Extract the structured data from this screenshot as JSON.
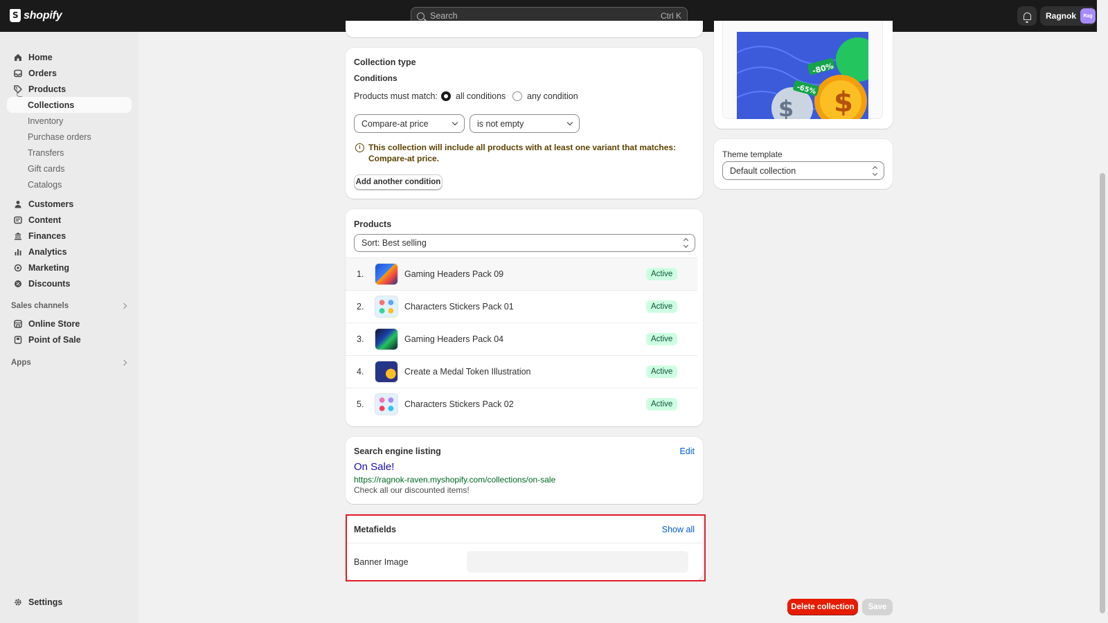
{
  "topbar": {
    "brand": "shopify",
    "search_placeholder": "Search",
    "search_shortcut": "Ctrl K",
    "user_name": "Ragnok",
    "avatar_initials": "Rag"
  },
  "sidebar": {
    "main": [
      "Home",
      "Orders",
      "Products"
    ],
    "products_sub": [
      "Collections",
      "Inventory",
      "Purchase orders",
      "Transfers",
      "Gift cards",
      "Catalogs"
    ],
    "more": [
      "Customers",
      "Content",
      "Finances",
      "Analytics",
      "Marketing",
      "Discounts"
    ],
    "sales_channels_heading": "Sales channels",
    "sales_channels": [
      "Online Store",
      "Point of Sale"
    ],
    "apps_heading": "Apps",
    "settings": "Settings"
  },
  "collection_type": {
    "title": "Collection type",
    "conditions_label": "Conditions",
    "match_label": "Products must match:",
    "option_all": "all conditions",
    "option_any": "any condition",
    "selected_option": "all conditions",
    "field_select": "Compare-at price",
    "operator_select": "is not empty",
    "notice": "This collection will include all products with at least one variant that matches: Compare-at price.",
    "add_condition_button": "Add another condition"
  },
  "products": {
    "title": "Products",
    "sort_label": "Sort: Best selling",
    "items": [
      {
        "num": "1.",
        "name": "Gaming Headers Pack 09",
        "status": "Active"
      },
      {
        "num": "2.",
        "name": "Characters Stickers Pack 01",
        "status": "Active"
      },
      {
        "num": "3.",
        "name": "Gaming Headers Pack 04",
        "status": "Active"
      },
      {
        "num": "4.",
        "name": "Create a Medal Token Illustration",
        "status": "Active"
      },
      {
        "num": "5.",
        "name": "Characters Stickers Pack 02",
        "status": "Active"
      }
    ]
  },
  "seo": {
    "title": "Search engine listing",
    "edit_label": "Edit",
    "page_title": "On Sale!",
    "url": "https://ragnok-raven.myshopify.com/collections/on-sale",
    "description": "Check all our discounted items!"
  },
  "metafields": {
    "title": "Metafields",
    "show_all": "Show all",
    "field_label": "Banner Image",
    "field_value": ""
  },
  "image_card": {
    "tag_1": "-80%",
    "tag_2": "-65%"
  },
  "theme_template": {
    "label": "Theme template",
    "value": "Default collection"
  },
  "actions": {
    "delete_label": "Delete collection",
    "save_label": "Save"
  },
  "colors": {
    "topbar": "#1a1a1a",
    "link": "#005bd3",
    "seo_title": "#1a0dab",
    "seo_url": "#006621",
    "danger": "#e51c00",
    "highlight": "#e11d2a",
    "badge_bg": "#cdfee1"
  }
}
